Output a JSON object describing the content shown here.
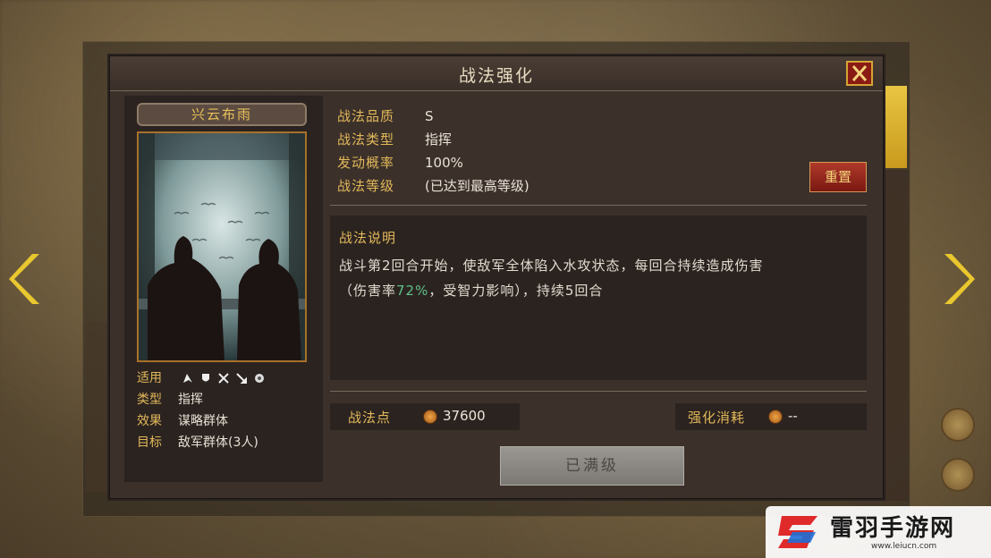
{
  "dialog": {
    "title": "战法强化",
    "close_label": "✕"
  },
  "skill": {
    "name": "兴云布雨",
    "attributes": [
      {
        "key": "适用",
        "value": ""
      },
      {
        "key": "类型",
        "value": "指挥"
      },
      {
        "key": "效果",
        "value": "谋略群体"
      },
      {
        "key": "目标",
        "value": "敌军群体(3人)"
      }
    ],
    "troop_icons": [
      "cavalry-icon",
      "shield-icon",
      "crossed-swords-icon",
      "spear-icon",
      "siege-icon"
    ]
  },
  "info": {
    "quality_label": "战法品质",
    "quality_value": "S",
    "type_label": "战法类型",
    "type_value": "指挥",
    "rate_label": "发动概率",
    "rate_value": "100%",
    "level_label": "战法等级",
    "level_value": "(已达到最高等级)",
    "reset_label": "重置"
  },
  "description": {
    "title": "战法说明",
    "line1": "战斗第2回合开始，使敌军全体陷入水攻状态，每回合持续造成伤害",
    "line2_prefix": "（伤害率",
    "line2_highlight": "72%",
    "line2_suffix": "，受智力影响），持续5回合",
    "highlight_color": "#5ec08a"
  },
  "points": {
    "label": "战法点",
    "value": "37600"
  },
  "cost": {
    "label": "强化消耗",
    "value": "--"
  },
  "maxed_button": {
    "label": "已满级"
  },
  "watermark": {
    "brand": "雷羽手游网",
    "url": "www.leiucn.com"
  }
}
